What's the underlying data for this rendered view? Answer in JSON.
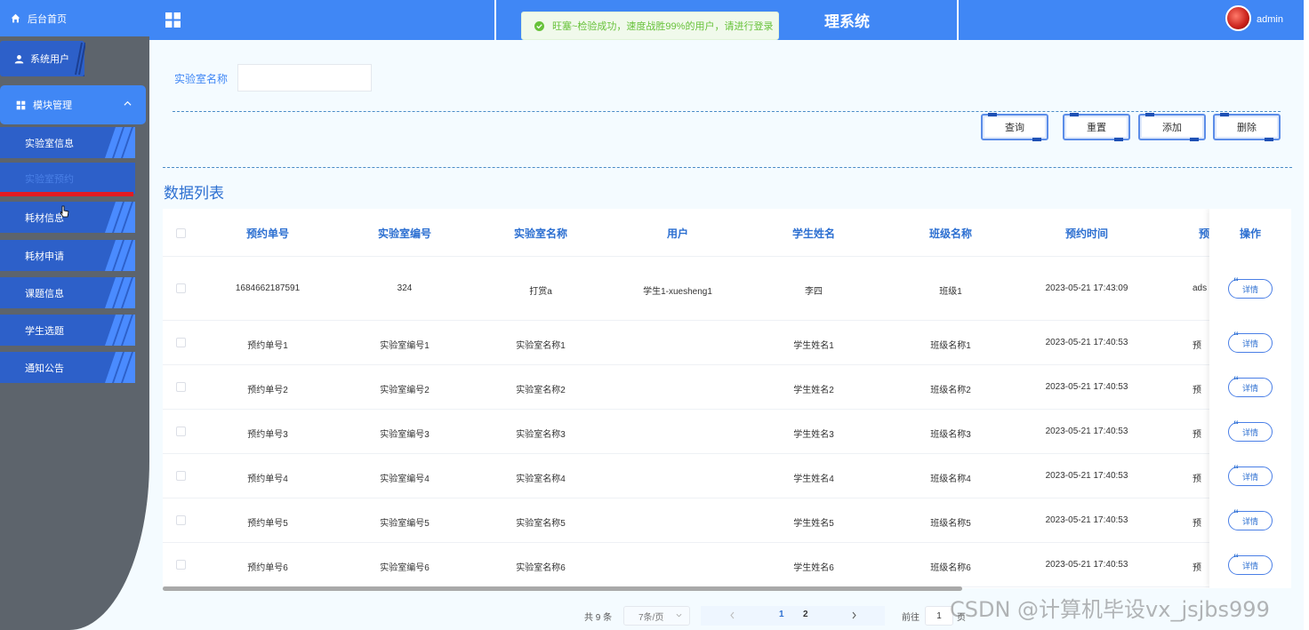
{
  "sidebar": {
    "home_label": "后台首页",
    "system_user_label": "系统用户",
    "module_label": "模块管理",
    "items": [
      {
        "label": "实验室信息",
        "active": false
      },
      {
        "label": "实验室预约",
        "active": true
      },
      {
        "label": "耗材信息",
        "active": false
      },
      {
        "label": "耗材申请",
        "active": false
      },
      {
        "label": "课题信息",
        "active": false
      },
      {
        "label": "学生选题",
        "active": false
      },
      {
        "label": "通知公告",
        "active": false
      }
    ]
  },
  "header": {
    "title": "理系统",
    "username": "admin"
  },
  "toast": {
    "message": "旺塞~检验成功，速度战胜99%的用户，请进行登录"
  },
  "search": {
    "label": "实验室名称",
    "value": ""
  },
  "actions": {
    "query": "查询",
    "reset": "重置",
    "add": "添加",
    "delete": "删除"
  },
  "list_title": "数据列表",
  "table": {
    "columns": [
      "预约单号",
      "实验室编号",
      "实验室名称",
      "用户",
      "学生姓名",
      "班级名称",
      "预约时间",
      "预",
      "操作"
    ],
    "detail_label": "详情",
    "rows": [
      [
        "1684662187591",
        "324",
        "打赏a",
        "学生1-xuesheng1",
        "李四",
        "班级1",
        "2023-05-21 17:43:09",
        "ads"
      ],
      [
        "预约单号1",
        "实验室编号1",
        "实验室名称1",
        "",
        "学生姓名1",
        "班级名称1",
        "2023-05-21 17:40:53",
        "预"
      ],
      [
        "预约单号2",
        "实验室编号2",
        "实验室名称2",
        "",
        "学生姓名2",
        "班级名称2",
        "2023-05-21 17:40:53",
        "预"
      ],
      [
        "预约单号3",
        "实验室编号3",
        "实验室名称3",
        "",
        "学生姓名3",
        "班级名称3",
        "2023-05-21 17:40:53",
        "预"
      ],
      [
        "预约单号4",
        "实验室编号4",
        "实验室名称4",
        "",
        "学生姓名4",
        "班级名称4",
        "2023-05-21 17:40:53",
        "预"
      ],
      [
        "预约单号5",
        "实验室编号5",
        "实验室名称5",
        "",
        "学生姓名5",
        "班级名称5",
        "2023-05-21 17:40:53",
        "预"
      ],
      [
        "预约单号6",
        "实验室编号6",
        "实验室名称6",
        "",
        "学生姓名6",
        "班级名称6",
        "2023-05-21 17:40:53",
        "预"
      ]
    ]
  },
  "pagination": {
    "total": "共 9 条",
    "page_size": "7条/页",
    "pages": [
      "1",
      "2"
    ],
    "current": "1",
    "goto_prefix": "前往",
    "goto_value": "1",
    "goto_suffix": "页"
  },
  "watermark": "CSDN @计算机毕设vx_jsjbs999",
  "colors": {
    "primary": "#4087f5",
    "sidebar_bg": "#5d646c",
    "menu_item": "#2d60c9",
    "active_underline": "#e21b22",
    "toast_text": "#67c23a"
  }
}
